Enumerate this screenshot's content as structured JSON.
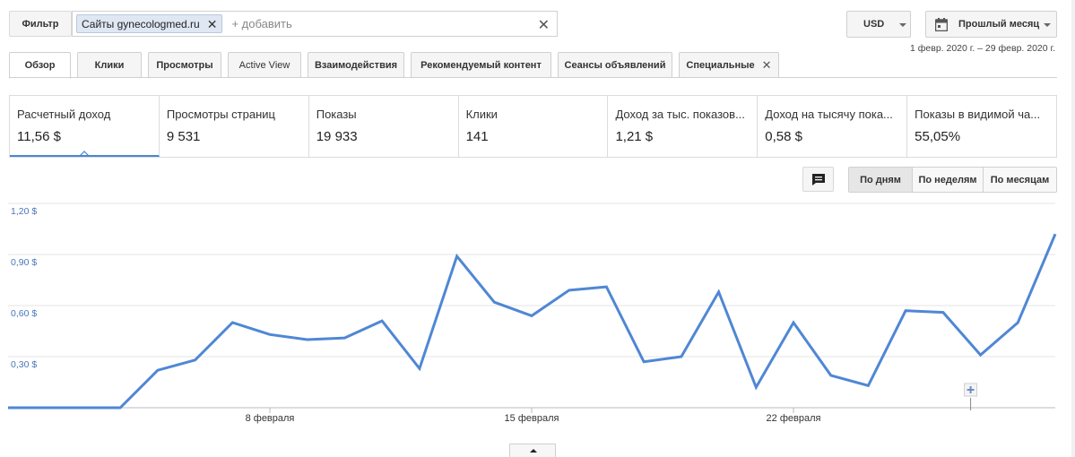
{
  "filter": {
    "label": "Фильтр",
    "chip": "Сайты gynecologmed.ru",
    "add_placeholder": "+ добавить"
  },
  "currency": "USD",
  "period": {
    "label": "Прошлый месяц",
    "range": "1 февр. 2020 г. – 29 февр. 2020 г."
  },
  "tabs": [
    {
      "label": "Обзор"
    },
    {
      "label": "Клики"
    },
    {
      "label": "Просмотры"
    },
    {
      "label": "Active View"
    },
    {
      "label": "Взаимодействия"
    },
    {
      "label": "Рекомендуемый контент"
    },
    {
      "label": "Сеансы объявлений"
    },
    {
      "label": "Специальные"
    }
  ],
  "metrics": [
    {
      "label": "Расчетный доход",
      "value": "11,56 $"
    },
    {
      "label": "Просмотры страниц",
      "value": "9 531"
    },
    {
      "label": "Показы",
      "value": "19 933"
    },
    {
      "label": "Клики",
      "value": "141"
    },
    {
      "label": "Доход за тыс. показов...",
      "value": "1,21 $"
    },
    {
      "label": "Доход на тысячу пока...",
      "value": "0,58 $"
    },
    {
      "label": "Показы в видимой ча...",
      "value": "55,05%"
    }
  ],
  "granularity": [
    {
      "label": "По дням"
    },
    {
      "label": "По неделям"
    },
    {
      "label": "По месяцам"
    }
  ],
  "colors": {
    "accent": "#4a86d1",
    "line": "#4f87d4",
    "axis_label": "#4a76b8"
  },
  "chart_data": {
    "type": "line",
    "x": [
      "1",
      "2",
      "3",
      "4",
      "5",
      "6",
      "7",
      "8",
      "9",
      "10",
      "11",
      "12",
      "13",
      "14",
      "15",
      "16",
      "17",
      "18",
      "19",
      "20",
      "21",
      "22",
      "23",
      "24",
      "25",
      "26",
      "27",
      "28",
      "29"
    ],
    "values": [
      0,
      0,
      0,
      0,
      0.22,
      0.28,
      0.5,
      0.43,
      0.4,
      0.41,
      0.51,
      0.23,
      0.89,
      0.62,
      0.54,
      0.69,
      0.71,
      0.27,
      0.3,
      0.68,
      0.12,
      0.5,
      0.19,
      0.13,
      0.57,
      0.56,
      0.31,
      0.5,
      1.02
    ],
    "yticks": [
      "1,20 $",
      "0,90 $",
      "0,60 $",
      "0,30 $"
    ],
    "ytick_values": [
      1.2,
      0.9,
      0.6,
      0.3
    ],
    "xticks": [
      "8 февраля",
      "15 февраля",
      "22 февраля"
    ],
    "xtick_days": [
      8,
      15,
      22
    ],
    "ylim": [
      0,
      1.2
    ],
    "grid": true
  }
}
